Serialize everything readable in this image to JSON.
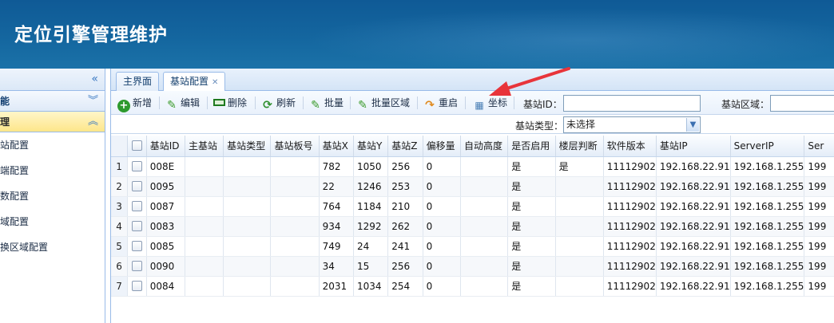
{
  "app": {
    "title": "定位引擎管理维护"
  },
  "sidebar": {
    "section1": "能",
    "section2": "理",
    "items": [
      {
        "label": "站配置"
      },
      {
        "label": "端配置"
      },
      {
        "label": "数配置"
      },
      {
        "label": "域配置"
      },
      {
        "label": "换区域配置"
      }
    ]
  },
  "tabs": [
    {
      "label": "主界面"
    },
    {
      "label": "基站配置"
    }
  ],
  "toolbar": {
    "add": "新增",
    "edit": "编辑",
    "delete": "删除",
    "refresh": "刷新",
    "batch": "批量",
    "batch_area": "批量区域",
    "restart": "重启",
    "coords": "坐标"
  },
  "filters": {
    "station_id_label": "基站ID：",
    "station_area_label": "基站区域：",
    "station_type_label": "基站类型：",
    "station_type_value": "未选择"
  },
  "grid": {
    "columns": [
      "基站ID",
      "主基站",
      "基站类型",
      "基站板号",
      "基站X",
      "基站Y",
      "基站Z",
      "偏移量",
      "自动高度",
      "是否启用",
      "楼层判断",
      "软件版本",
      "基站IP",
      "ServerIP",
      "Ser"
    ],
    "rows": [
      {
        "n": "1",
        "cells": [
          "008E",
          "",
          "",
          "",
          "782",
          "1050",
          "256",
          "0",
          "",
          "是",
          "是",
          "11112902",
          "192.168.22.91",
          "192.168.1.255",
          "199"
        ]
      },
      {
        "n": "2",
        "cells": [
          "0095",
          "",
          "",
          "",
          "22",
          "1246",
          "253",
          "0",
          "",
          "是",
          "",
          "11112902",
          "192.168.22.91",
          "192.168.1.255",
          "199"
        ]
      },
      {
        "n": "3",
        "cells": [
          "0087",
          "",
          "",
          "",
          "764",
          "1184",
          "210",
          "0",
          "",
          "是",
          "",
          "11112902",
          "192.168.22.91",
          "192.168.1.255",
          "199"
        ]
      },
      {
        "n": "4",
        "cells": [
          "0083",
          "",
          "",
          "",
          "934",
          "1292",
          "262",
          "0",
          "",
          "是",
          "",
          "11112902",
          "192.168.22.91",
          "192.168.1.255",
          "199"
        ]
      },
      {
        "n": "5",
        "cells": [
          "0085",
          "",
          "",
          "",
          "749",
          "24",
          "241",
          "0",
          "",
          "是",
          "",
          "11112902",
          "192.168.22.91",
          "192.168.1.255",
          "199"
        ]
      },
      {
        "n": "6",
        "cells": [
          "0090",
          "",
          "",
          "",
          "34",
          "15",
          "256",
          "0",
          "",
          "是",
          "",
          "11112902",
          "192.168.22.91",
          "192.168.1.255",
          "199"
        ]
      },
      {
        "n": "7",
        "cells": [
          "0084",
          "",
          "",
          "",
          "2031",
          "1034",
          "254",
          "0",
          "",
          "是",
          "",
          "11112902",
          "192.168.22.91",
          "192.168.1.255",
          "199"
        ]
      }
    ]
  },
  "colors": {
    "header": "#14669f",
    "annotation_arrow": "#e8343a",
    "selected_section": "#fde68a"
  }
}
